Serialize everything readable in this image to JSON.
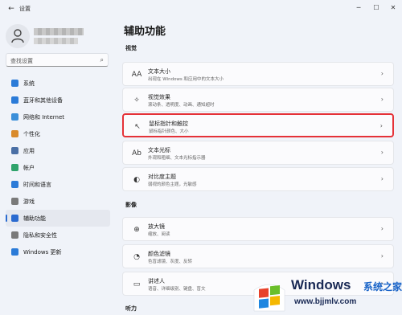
{
  "window": {
    "app_title": "设置",
    "back_glyph": "←",
    "min_glyph": "─",
    "max_glyph": "☐",
    "close_glyph": "✕"
  },
  "search": {
    "placeholder": "查找设置",
    "icon": "search-icon"
  },
  "sidebar": {
    "items": [
      {
        "label": "系统",
        "icon": "display-icon",
        "color": "#2b7bd8"
      },
      {
        "label": "蓝牙和其他设备",
        "icon": "bluetooth-icon",
        "color": "#2b7bd8"
      },
      {
        "label": "网络和 Internet",
        "icon": "wifi-icon",
        "color": "#3b8fd9"
      },
      {
        "label": "个性化",
        "icon": "brush-icon",
        "color": "#d98a2b"
      },
      {
        "label": "应用",
        "icon": "apps-icon",
        "color": "#4a6fa5"
      },
      {
        "label": "帐户",
        "icon": "account-icon",
        "color": "#2fa36b"
      },
      {
        "label": "时间和语言",
        "icon": "clock-globe-icon",
        "color": "#2b7bd8"
      },
      {
        "label": "游戏",
        "icon": "gamepad-icon",
        "color": "#7a7a7a"
      },
      {
        "label": "辅助功能",
        "icon": "accessibility-icon",
        "color": "#2b6bd0",
        "active": true
      },
      {
        "label": "隐私和安全性",
        "icon": "shield-icon",
        "color": "#7a7a7a"
      },
      {
        "label": "Windows 更新",
        "icon": "update-icon",
        "color": "#2b7bd8"
      }
    ]
  },
  "main": {
    "title": "辅助功能",
    "sections": [
      {
        "label": "视觉",
        "cards": [
          {
            "title": "文本大小",
            "desc": "出现在 Windows 和应用中的文本大小",
            "icon": "text-size-icon",
            "glyph": "AA"
          },
          {
            "title": "视觉效果",
            "desc": "滚动条、透明度、动画、通知超时",
            "icon": "sparkle-icon",
            "glyph": "✧"
          },
          {
            "title": "鼠标指针和触控",
            "desc": "鼠标指针颜色、大小",
            "icon": "pointer-touch-icon",
            "glyph": "↖",
            "highlight": true
          },
          {
            "title": "文本光标",
            "desc": "外观和粗细、文本光标指示器",
            "icon": "text-cursor-icon",
            "glyph": "Ab"
          },
          {
            "title": "对比度主题",
            "desc": "弱视的颜色主题，光敏感",
            "icon": "contrast-icon",
            "glyph": "◐"
          }
        ]
      },
      {
        "label": "影像",
        "cards": [
          {
            "title": "放大镜",
            "desc": "缩放、阅读",
            "icon": "magnifier-icon",
            "glyph": "⊕"
          },
          {
            "title": "颜色滤镜",
            "desc": "色盲滤镜、灰度、反转",
            "icon": "color-filter-icon",
            "glyph": "◔"
          },
          {
            "title": "讲述人",
            "desc": "语音、详细级别、键盘、盲文",
            "icon": "narrator-icon",
            "glyph": "▭"
          }
        ]
      },
      {
        "label": "听力",
        "cards": []
      }
    ],
    "chevron": "›"
  },
  "watermark": {
    "title": "Windows",
    "cn": "系统之家",
    "url": "www.bjjmlv.com"
  }
}
